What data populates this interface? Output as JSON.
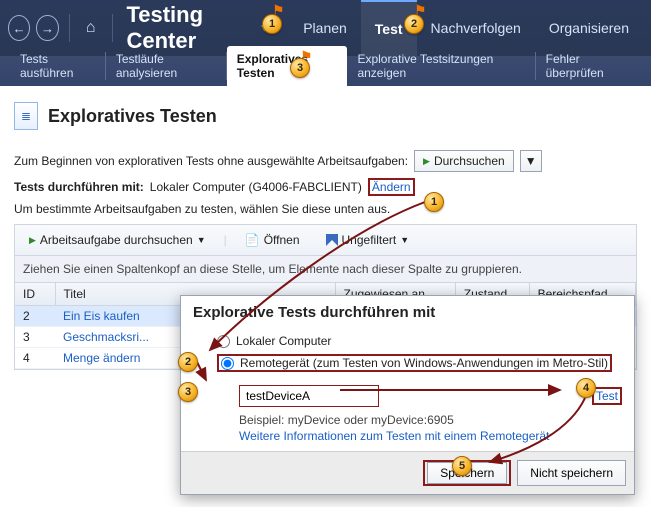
{
  "header": {
    "app_title": "Testing Center",
    "nav": {
      "plan": "Planen",
      "test": "Test",
      "track": "Nachverfolgen",
      "organize": "Organisieren"
    }
  },
  "subnav": {
    "run": "Tests ausführen",
    "analyze": "Testläufe analysieren",
    "exploratory": "Exploratives Testen",
    "sessions": "Explorative Testsitzungen anzeigen",
    "verify": "Fehler überprüfen"
  },
  "page": {
    "title": "Exploratives Testen",
    "intro": "Zum Beginnen von explorativen Tests ohne ausgewählte Arbeitsaufgaben:",
    "browse": "Durchsuchen",
    "perform_label": "Tests durchführen mit:",
    "perform_value": "Lokaler Computer (G4006-FABCLIENT)",
    "change": "Ändern",
    "work_items_hint": "Um bestimmte Arbeitsaufgaben zu testen, wählen Sie diese unten aus."
  },
  "toolbar": {
    "browse_wi": "Arbeitsaufgabe durchsuchen",
    "open": "Öffnen",
    "filter": "Ungefiltert"
  },
  "grid": {
    "group_hint": "Ziehen Sie einen Spaltenkopf an diese Stelle, um Elemente nach dieser Spalte zu gruppieren.",
    "cols": {
      "id": "ID",
      "title": "Titel",
      "assigned": "Zugewiesen an",
      "state": "Zustand",
      "area": "Bereichspfad"
    },
    "rows": [
      {
        "id": "2",
        "title": "Ein Eis kaufen"
      },
      {
        "id": "3",
        "title": "Geschmacksri..."
      },
      {
        "id": "4",
        "title": "Menge ändern"
      }
    ]
  },
  "dialog": {
    "title": "Explorative Tests durchführen mit",
    "opt_local": "Lokaler Computer",
    "opt_remote": "Remotegerät (zum Testen von Windows-Anwendungen im Metro-Stil)",
    "device_value": "testDeviceA",
    "test_btn": "Test",
    "example": "Beispiel: myDevice oder myDevice:6905",
    "more_info": "Weitere Informationen zum Testen mit einem Remotegerät",
    "save": "Speichern",
    "dont_save": "Nicht speichern"
  },
  "callouts": {
    "top1": "1",
    "top2": "2",
    "top3": "3",
    "c1": "1",
    "c2": "2",
    "c3": "3",
    "c4": "4",
    "c5": "5"
  }
}
